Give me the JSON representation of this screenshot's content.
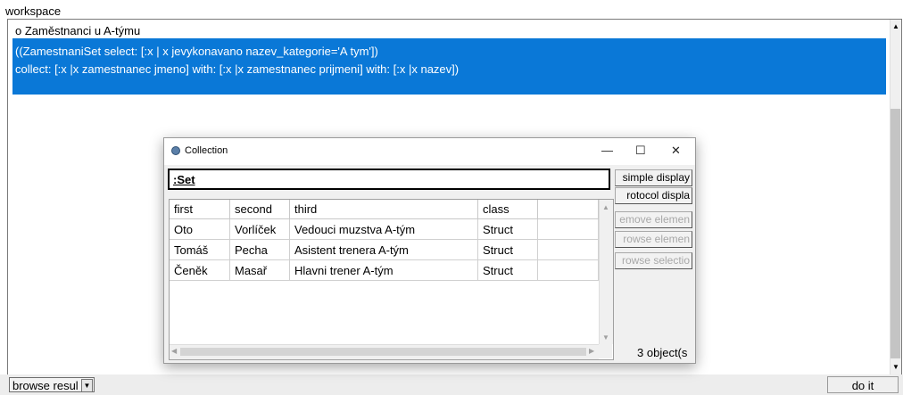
{
  "workspace": {
    "label": "workspace",
    "comment_line": "o   Zaměstnanci u A-týmu",
    "code_lines": [
      "((ZamestnaniSet select: [:x | x jevykonavano nazev_kategorie='A tym'])",
      "collect: [:x |x zamestnanec jmeno] with: [:x |x zamestnanec prijmeni] with: [:x |x nazev])"
    ],
    "selection_color": "#0a78d7"
  },
  "bottom": {
    "browse_result": "browse resul",
    "do_it": "do it"
  },
  "collection_window": {
    "title": "Collection",
    "controls": {
      "minimize": "—",
      "maximize": "☐",
      "close": "✕"
    },
    "set_label": ":Set",
    "columns": [
      "first",
      "second",
      "third",
      "class",
      ""
    ],
    "rows": [
      [
        "Oto",
        "Vorlíček",
        "Vedouci muzstva A-tým",
        "Struct"
      ],
      [
        "Tomáš",
        "Pecha",
        "Asistent trenera A-tým",
        "Struct"
      ],
      [
        "Čeněk",
        "Masař",
        "Hlavni trener A-tým",
        "Struct"
      ]
    ],
    "buttons": {
      "simple_display": "simple display",
      "protocol_display": "rotocol displa",
      "remove_element": "emove elemen",
      "browse_element": "rowse elemen",
      "browse_selection": "rowse selectio"
    },
    "object_count": "3",
    "object_label": "object(s"
  }
}
